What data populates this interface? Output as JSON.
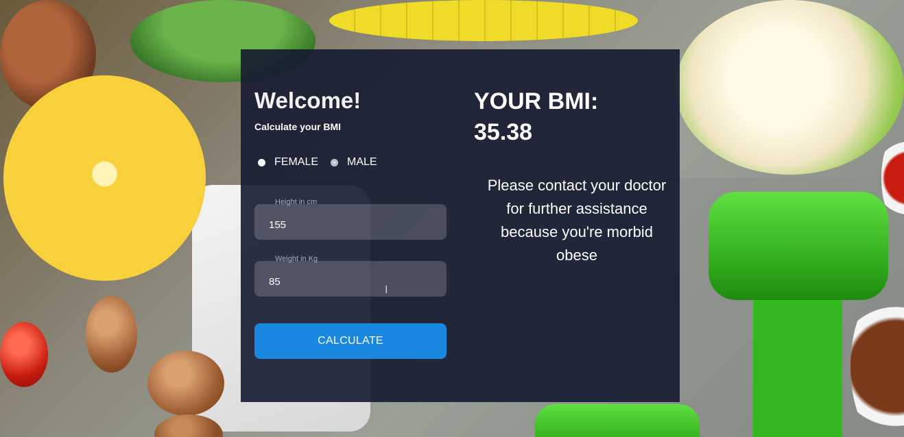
{
  "form": {
    "title": "Welcome!",
    "subtitle": "Calculate your BMI",
    "gender_options": [
      {
        "label": "FEMALE",
        "selected": true
      },
      {
        "label": "MALE",
        "selected": false
      }
    ],
    "height": {
      "label": "Height in cm",
      "value": "155"
    },
    "weight": {
      "label": "Weight in Kg",
      "value": "85"
    },
    "calculate_label": "CALCULATE"
  },
  "result": {
    "heading": "YOUR BMI:",
    "value": "35.38",
    "message": "Please contact your doctor for further assistance because you're morbid obese"
  },
  "colors": {
    "panel": "#141a30",
    "button": "#1a88e0",
    "text": "#ffffff"
  }
}
